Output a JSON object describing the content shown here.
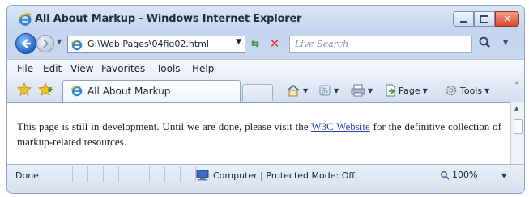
{
  "window": {
    "title": "All About Markup - Windows Internet Explorer"
  },
  "address_bar": {
    "url": "G:\\Web Pages\\04fig02.html",
    "search_placeholder": "Live Search"
  },
  "menu": {
    "items": [
      "File",
      "Edit",
      "View",
      "Favorites",
      "Tools",
      "Help"
    ]
  },
  "tab": {
    "label": "All About Markup"
  },
  "command_bar": {
    "page_label": "Page",
    "tools_label": "Tools"
  },
  "content": {
    "text_before": "This page is still in development. Until we are done, please visit the ",
    "link_text": "W3C Website",
    "text_after": " for the definitive collection of markup-related resources."
  },
  "status_bar": {
    "status": "Done",
    "zone": "Computer | Protected Mode: Off",
    "zoom": "100%"
  },
  "icons": {
    "app": "ie-logo-icon",
    "back": "back-arrow-icon",
    "forward": "forward-arrow-icon",
    "refresh": "refresh-icon",
    "stop": "stop-icon",
    "search": "search-icon",
    "favorites": "favorites-star-icon",
    "add_favorites": "add-favorites-icon",
    "home": "home-icon",
    "feeds": "feeds-icon",
    "print": "print-icon",
    "zone": "computer-zone-icon",
    "zoom": "zoom-icon"
  }
}
